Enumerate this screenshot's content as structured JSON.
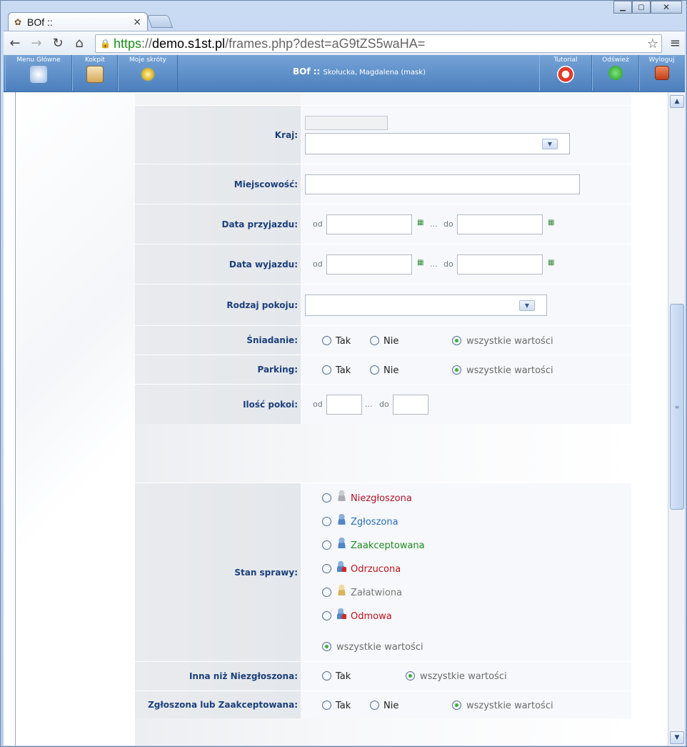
{
  "browser": {
    "tab_title": "BOf ::",
    "url_scheme": "https",
    "url_host": "demo.s1st.pl",
    "url_path": "/frames.php?dest=aG9tZS5waHA="
  },
  "appbar": {
    "menu_glowne": "Menu Główne",
    "kokpit": "Kokpit",
    "moje_skroty": "Moje skróty",
    "title": "BOf ::",
    "user": "Skołucka, Magdalena (mask)",
    "tutorial": "Tutorial",
    "odswiez": "Odśwież",
    "wyloguj": "Wyloguj"
  },
  "form": {
    "kraj": "Kraj:",
    "miejscowosc": "Miejscowość:",
    "data_przyjazdu": "Data przyjazdu:",
    "data_wyjazdu": "Data wyjazdu:",
    "rodzaj_pokoju": "Rodzaj pokoju:",
    "sniadanie": "Śniadanie:",
    "parking": "Parking:",
    "ilosc_pokoi": "Ilość pokoi:",
    "stan_sprawy": "Stan sprawy:",
    "inna_niz": "Inna niż Niezgłoszona:",
    "zgloszona_lub": "Zgłoszona lub Zaakceptowana:",
    "od": "od",
    "do": "do",
    "dots": "...",
    "tak": "Tak",
    "nie": "Nie",
    "wszystkie": "wszystkie wartości"
  },
  "statuses": [
    {
      "label": "Niezgłoszona",
      "color": "#b0122a"
    },
    {
      "label": "Zgłoszona",
      "color": "#2a6db5"
    },
    {
      "label": "Zaakceptowana",
      "color": "#1f8a1f"
    },
    {
      "label": "Odrzucona",
      "color": "#c0121a"
    },
    {
      "label": "Załatwiona",
      "color": "#777777"
    },
    {
      "label": "Odmowa",
      "color": "#c0121a"
    }
  ]
}
